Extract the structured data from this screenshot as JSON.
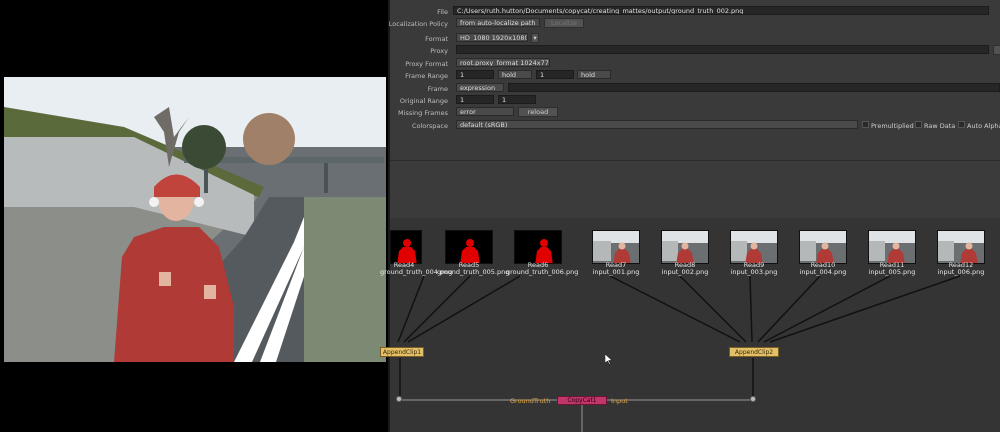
{
  "properties": {
    "file_label": "File",
    "file_value": "C:/Users/ruth.hutton/Documents/copycat/creating_mattes/output/ground_truth_002.png",
    "localization_label": "Localization Policy",
    "localization_value": "from auto-localize path",
    "localize_button": "Localize",
    "format_label": "Format",
    "format_value": "HD_1080 1920x1080",
    "proxy_label": "Proxy",
    "proxy_value": "",
    "proxy_format_label": "Proxy Format",
    "proxy_format_value": "root.proxy_format 1024x778",
    "frame_range_label": "Frame Range",
    "frame_range_start": "1",
    "frame_range_start_mode": "hold",
    "frame_range_end": "1",
    "frame_range_end_mode": "hold",
    "frame_label": "Frame",
    "frame_mode": "expression",
    "original_range_label": "Original Range",
    "original_range_start": "1",
    "original_range_end": "1",
    "missing_frames_label": "Missing Frames",
    "missing_frames_value": "error",
    "reload_button": "reload",
    "colorspace_label": "Colorspace",
    "colorspace_value": "default (sRGB)",
    "premultiplied_label": "Premultiplied",
    "raw_data_label": "Raw Data",
    "auto_alpha_label": "Auto Alpha"
  },
  "nodes": {
    "read4": {
      "name": "Read4",
      "file": "ground_truth_004.png"
    },
    "read5": {
      "name": "Read5",
      "file": "ground_truth_005.png"
    },
    "read6": {
      "name": "Read6",
      "file": "ground_truth_006.png"
    },
    "read7": {
      "name": "Read7",
      "file": "input_001.png"
    },
    "read8": {
      "name": "Read8",
      "file": "input_002.png"
    },
    "read9": {
      "name": "Read9",
      "file": "input_003.png"
    },
    "read10": {
      "name": "Read10",
      "file": "input_004.png"
    },
    "read11": {
      "name": "Read11",
      "file": "input_005.png"
    },
    "read12": {
      "name": "Read12",
      "file": "input_006.png"
    },
    "append1": "AppendClip1",
    "append2": "AppendClip2",
    "copycat": "CopyCat1",
    "ground_truth_label": "GroundTruth",
    "input_label": "Input"
  },
  "colors": {
    "matte_red": "#e00000",
    "append_node": "#e2c06a",
    "copycat_node": "#c0366a",
    "edge_label": "#e3a743"
  }
}
